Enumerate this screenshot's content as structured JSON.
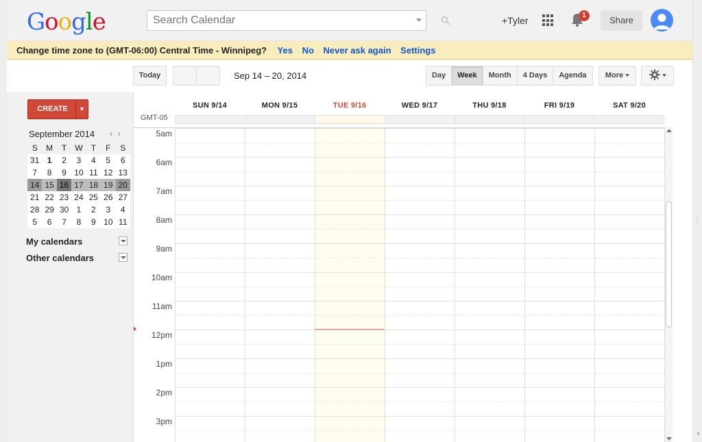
{
  "header": {
    "logo_letters": [
      {
        "ch": "G",
        "color": "#3369e8"
      },
      {
        "ch": "o",
        "color": "#d50f25"
      },
      {
        "ch": "o",
        "color": "#eeb211"
      },
      {
        "ch": "g",
        "color": "#3369e8"
      },
      {
        "ch": "l",
        "color": "#009925"
      },
      {
        "ch": "e",
        "color": "#d50f25"
      }
    ],
    "search_placeholder": "Search Calendar",
    "user_link": "+Tyler",
    "notification_count": "1",
    "share_label": "Share"
  },
  "notice": {
    "message": "Change time zone to (GMT-06:00) Central Time - Winnipeg?",
    "yes": "Yes",
    "no": "No",
    "never": "Never ask again",
    "settings": "Settings"
  },
  "toolbar": {
    "today": "Today",
    "date_range": "Sep 14 – 20, 2014",
    "views": [
      "Day",
      "Week",
      "Month",
      "4 Days",
      "Agenda"
    ],
    "active_view": "Week",
    "more": "More"
  },
  "sidebar": {
    "create": "CREATE",
    "mini_month": "September 2014",
    "weekdays": [
      "S",
      "M",
      "T",
      "W",
      "T",
      "F",
      "S"
    ],
    "weeks": [
      [
        "31",
        "1",
        "2",
        "3",
        "4",
        "5",
        "6"
      ],
      [
        "7",
        "8",
        "9",
        "10",
        "11",
        "12",
        "13"
      ],
      [
        "14",
        "15",
        "16",
        "17",
        "18",
        "19",
        "20"
      ],
      [
        "21",
        "22",
        "23",
        "24",
        "25",
        "26",
        "27"
      ],
      [
        "28",
        "29",
        "30",
        "1",
        "2",
        "3",
        "4"
      ],
      [
        "5",
        "6",
        "7",
        "8",
        "9",
        "10",
        "11"
      ]
    ],
    "my_calendars": "My calendars",
    "other_calendars": "Other calendars"
  },
  "calendar": {
    "timezone": "GMT-05",
    "days": [
      "SUN 9/14",
      "MON 9/15",
      "TUE 9/16",
      "WED 9/17",
      "THU 9/18",
      "FRI 9/19",
      "SAT 9/20"
    ],
    "today_index": 2,
    "hours": [
      "5am",
      "6am",
      "7am",
      "8am",
      "9am",
      "10am",
      "11am",
      "12pm",
      "1pm",
      "2pm",
      "3pm"
    ]
  },
  "colors": {
    "create_red": "#d14836",
    "notice_bg": "#f9edbe",
    "link_blue": "#1155cc",
    "now_line": "#e66c5a"
  }
}
